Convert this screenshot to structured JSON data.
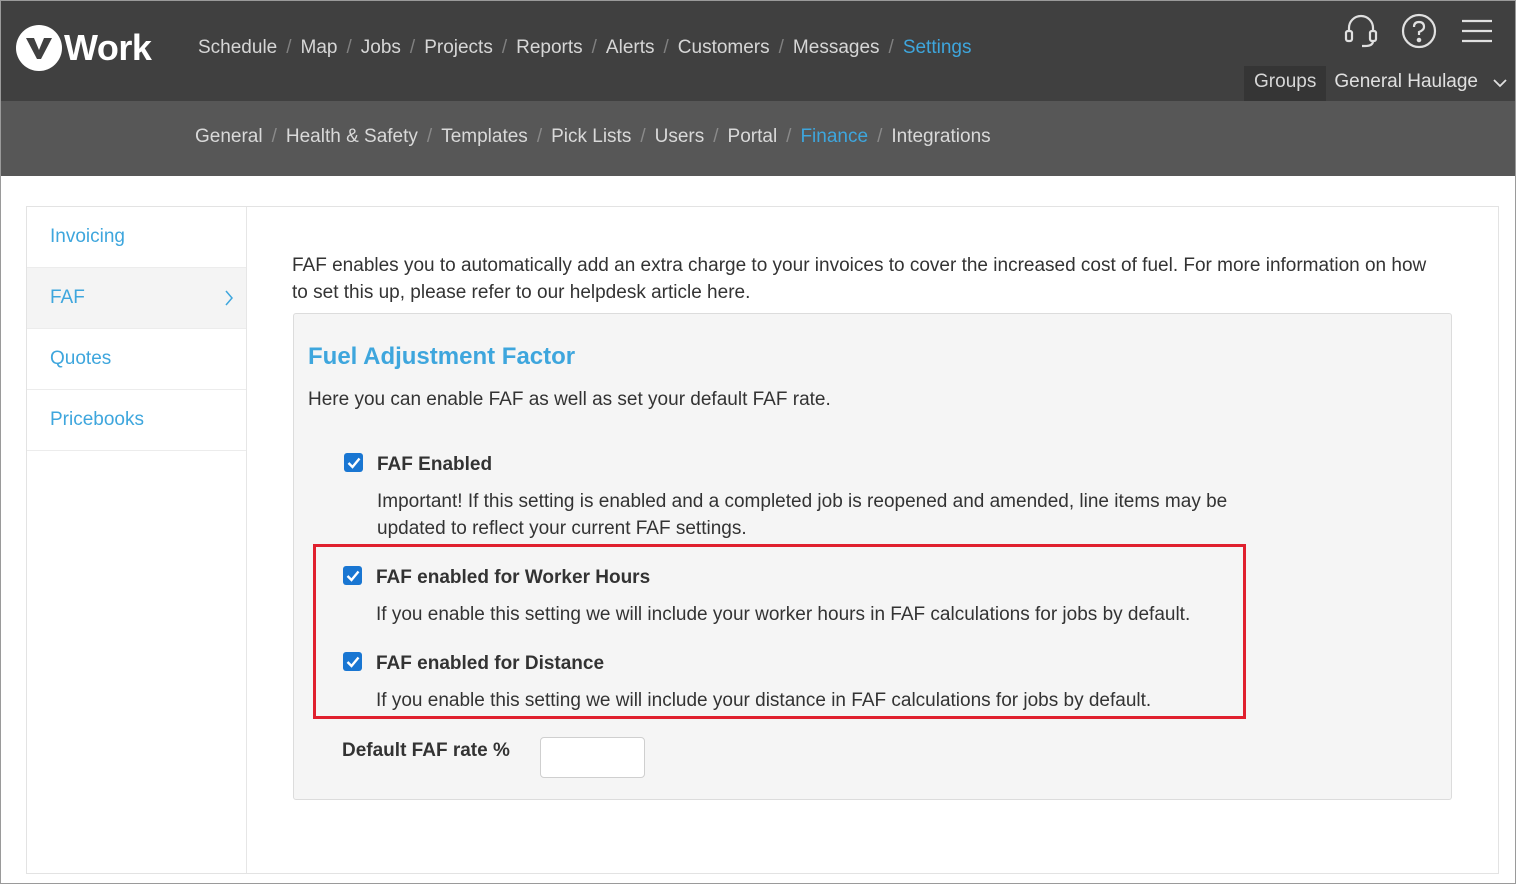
{
  "brand": {
    "logo_text": "Work",
    "logo_letter": "v"
  },
  "main_nav": [
    {
      "label": "Schedule"
    },
    {
      "label": "Map"
    },
    {
      "label": "Jobs"
    },
    {
      "label": "Projects"
    },
    {
      "label": "Reports"
    },
    {
      "label": "Alerts"
    },
    {
      "label": "Customers"
    },
    {
      "label": "Messages"
    },
    {
      "label": "Settings",
      "active": true
    }
  ],
  "top_icons": [
    "headset-icon",
    "help-icon",
    "menu-icon"
  ],
  "group_bar": {
    "groups_label": "Groups",
    "selected_group": "General Haulage"
  },
  "sub_nav": [
    {
      "label": "General"
    },
    {
      "label": "Health & Safety"
    },
    {
      "label": "Templates"
    },
    {
      "label": "Pick Lists"
    },
    {
      "label": "Users"
    },
    {
      "label": "Portal"
    },
    {
      "label": "Finance",
      "active": true
    },
    {
      "label": "Integrations"
    }
  ],
  "sidebar": [
    {
      "label": "Invoicing"
    },
    {
      "label": "FAF",
      "active": true
    },
    {
      "label": "Quotes"
    },
    {
      "label": "Pricebooks"
    }
  ],
  "intro_text": "FAF enables you to automatically add an extra charge to your invoices to cover the increased cost of fuel. For more information on how to set this up, please refer to our helpdesk article here.",
  "panel": {
    "title": "Fuel Adjustment Factor",
    "description": "Here you can enable FAF as well as set your default FAF rate.",
    "options": [
      {
        "label": "FAF Enabled",
        "checked": true,
        "description": "Important! If this setting is enabled and a completed job is reopened and amended, line items may be updated to reflect your current FAF settings."
      },
      {
        "label": "FAF enabled for Worker Hours",
        "checked": true,
        "description": "If you enable this setting we will include your worker hours in FAF calculations for jobs by default."
      },
      {
        "label": "FAF enabled for Distance",
        "checked": true,
        "description": "If you enable this setting we will include your distance in FAF calculations for jobs by default."
      }
    ],
    "rate_label": "Default FAF rate %",
    "rate_value": ""
  },
  "colors": {
    "accent": "#3ea6dd",
    "topbar": "#404040",
    "subbar": "#575757",
    "highlight": "#e0202e",
    "checkbox": "#1976d2"
  }
}
